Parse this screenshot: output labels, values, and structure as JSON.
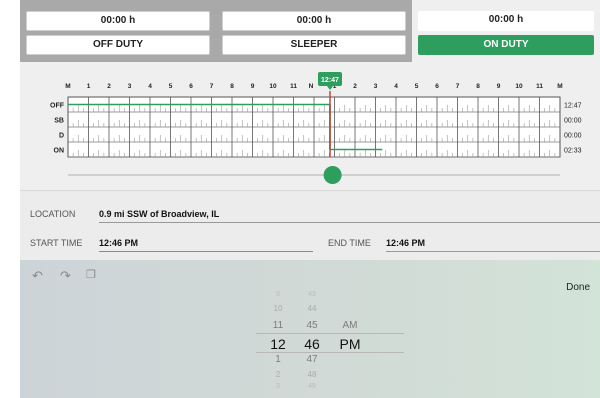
{
  "status": {
    "columns": [
      {
        "hours": "00:00 h",
        "label": "OFF DUTY",
        "active": false
      },
      {
        "hours": "00:00 h",
        "label": "SLEEPER",
        "active": false
      },
      {
        "hours": "00:00 h",
        "label": "ON DUTY",
        "active": true
      }
    ],
    "active_color": "#2e9e5e"
  },
  "graph": {
    "hour_labels": [
      "M",
      "1",
      "2",
      "3",
      "4",
      "5",
      "6",
      "7",
      "8",
      "9",
      "10",
      "11",
      "N",
      "1",
      "2",
      "3",
      "4",
      "5",
      "6",
      "7",
      "8",
      "9",
      "10",
      "11",
      "M"
    ],
    "row_labels": [
      "OFF",
      "SB",
      "D",
      "ON"
    ],
    "row_totals": [
      "12:47",
      "00:00",
      "00:00",
      "02:33"
    ],
    "current_time_marker": "12:47",
    "current_time_hour": 12.78,
    "segments": [
      {
        "row": "OFF",
        "from_hour": 0,
        "to_hour": 12.78
      },
      {
        "row": "ON",
        "from_hour": 12.78,
        "to_hour": 15.33
      }
    ],
    "slider_position": 0.55
  },
  "form": {
    "location_label": "LOCATION",
    "location_value": "0.9 mi SSW of Broadview, IL",
    "start_label": "START TIME",
    "start_value": "12:46 PM",
    "end_label": "END TIME",
    "end_value": "12:46 PM"
  },
  "picker": {
    "done_label": "Done",
    "icons": [
      "undo-icon",
      "redo-icon",
      "paste-icon"
    ],
    "hours": [
      "9",
      "10",
      "11",
      "12",
      "1",
      "2",
      "3"
    ],
    "minutes": [
      "43",
      "44",
      "45",
      "46",
      "47",
      "48",
      "49"
    ],
    "ampm": [
      "AM",
      "PM"
    ],
    "selected": {
      "hour": "12",
      "minute": "46",
      "ampm": "PM"
    }
  }
}
